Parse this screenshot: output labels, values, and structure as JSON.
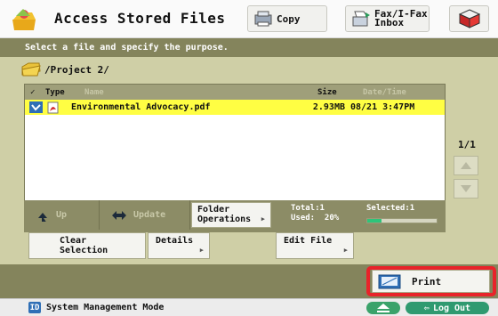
{
  "header": {
    "title": "Access Stored Files",
    "copy_label": "Copy",
    "fax_label_line1": "Fax/I-Fax",
    "fax_label_line2": "Inbox"
  },
  "panel": {
    "instruction": "Select a file and specify the purpose.",
    "path": "/Project 2/"
  },
  "file_list": {
    "columns": {
      "type": "Type",
      "name": "Name",
      "size": "Size",
      "date": "Date/Time"
    },
    "rows": [
      {
        "name": "Environmental Advocacy.pdf",
        "size": "2.93MB",
        "date": "08/21 3:47PM",
        "selected": true
      }
    ]
  },
  "pager": {
    "page": "1/1"
  },
  "actions": {
    "up_label": "Up",
    "update_label": "Update",
    "folder_ops_line1": "Folder",
    "folder_ops_line2": "Operations",
    "total_text": "Total:1",
    "used_text": "Used:  20%",
    "selected_text": "Selected:1",
    "used_percent": 20
  },
  "options": {
    "clear_line1": "Clear",
    "clear_line2": "Selection",
    "details_label": "Details",
    "edit_label": "Edit File"
  },
  "print": {
    "label": "Print"
  },
  "footer": {
    "system_mode": "System Management Mode",
    "logout_label": "Log Out"
  },
  "colors": {
    "panel": "#cfcfa6",
    "bar_dark": "#84845c",
    "selected_row": "#fffe43",
    "highlight": "#e8232a",
    "usage": "#2ec47a"
  }
}
